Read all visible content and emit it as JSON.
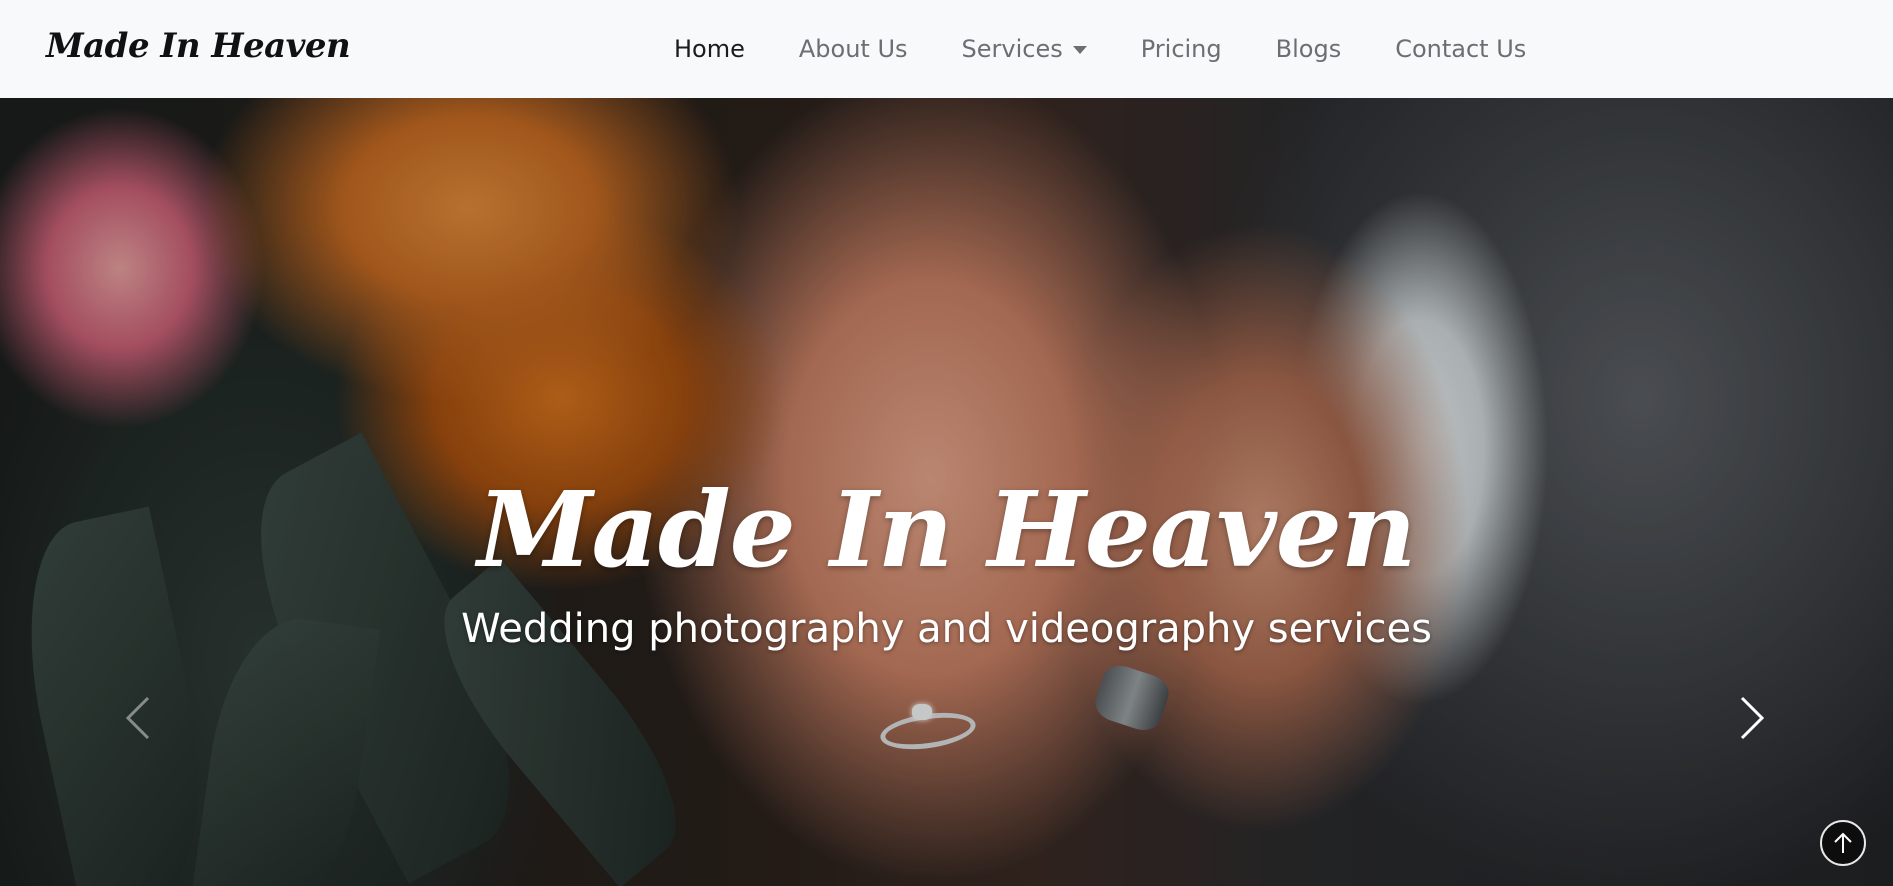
{
  "navbar": {
    "brand": "Made In Heaven",
    "items": [
      {
        "label": "Home",
        "active": true
      },
      {
        "label": "About Us",
        "active": false
      },
      {
        "label": "Services",
        "active": false,
        "dropdown": true
      },
      {
        "label": "Pricing",
        "active": false
      },
      {
        "label": "Blogs",
        "active": false
      },
      {
        "label": "Contact Us",
        "active": false
      }
    ]
  },
  "hero": {
    "title": "Made In Heaven",
    "subtitle": "Wedding photography and videography services",
    "prev_icon": "chevron-left-icon",
    "next_icon": "chevron-right-icon"
  },
  "back_to_top": {
    "icon": "arrow-up-icon"
  },
  "colors": {
    "navbar_bg": "#f8f9fa",
    "nav_active": "#1c1c1c",
    "nav_inactive": "#6c6f72",
    "hero_text": "#ffffff"
  }
}
